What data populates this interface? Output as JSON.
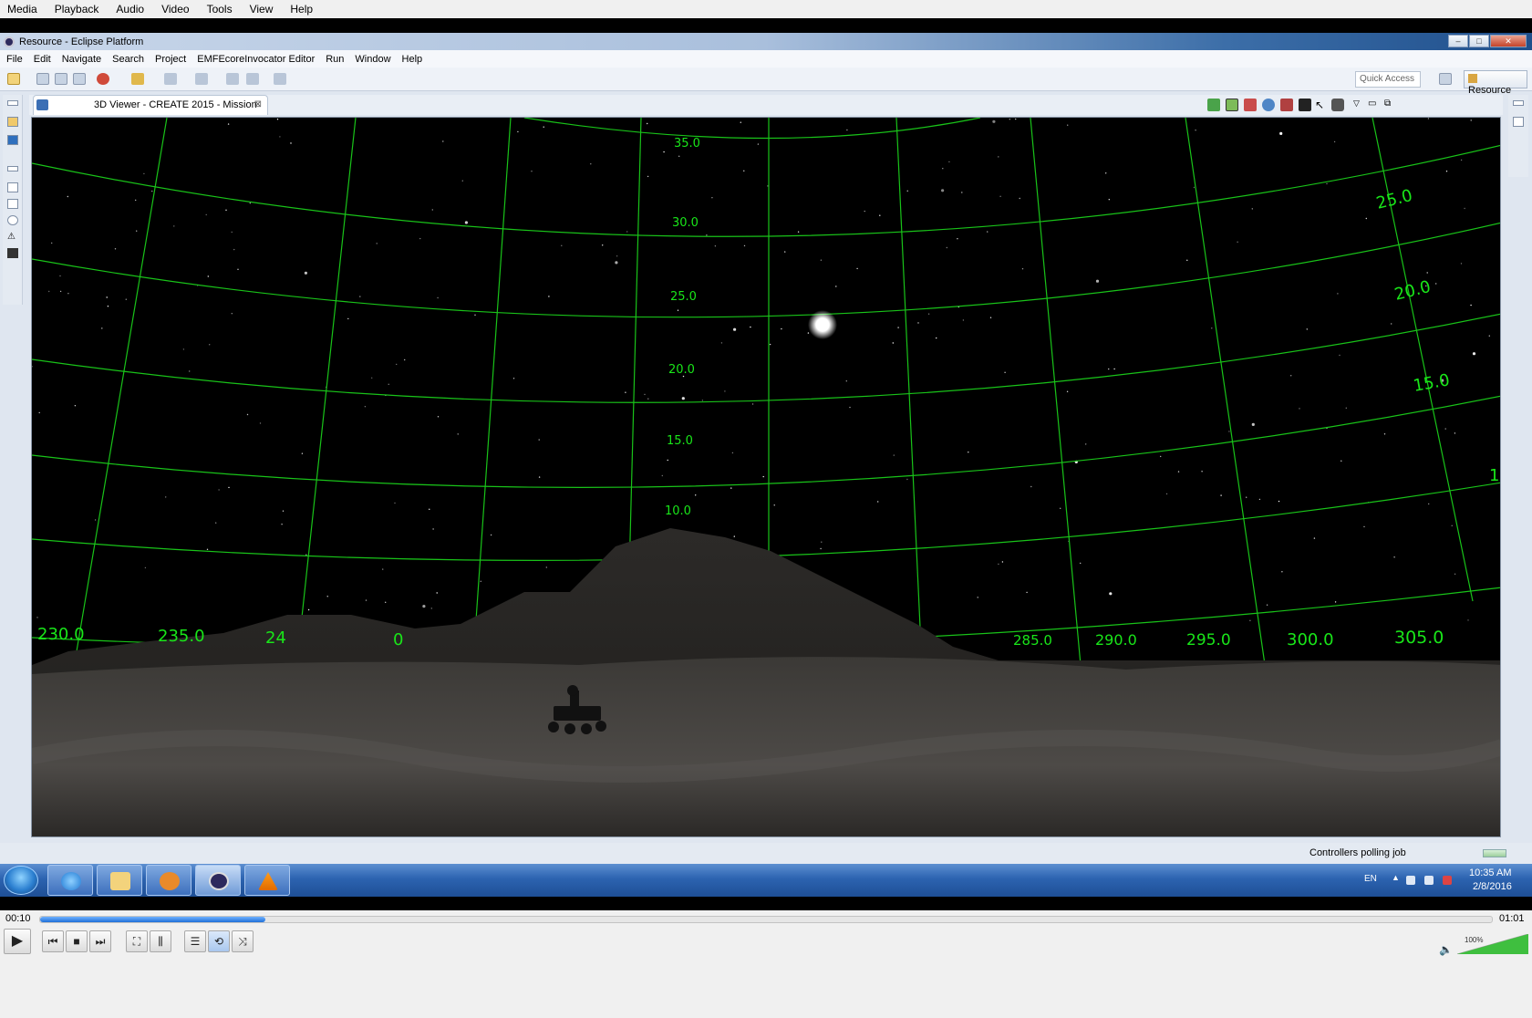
{
  "vlc": {
    "menu": [
      "Media",
      "Playback",
      "Audio",
      "Video",
      "Tools",
      "View",
      "Help"
    ],
    "time_elapsed": "00:10",
    "time_total": "01:01",
    "progress_fraction": 0.155,
    "volume_label": "100%",
    "volume_fraction": 1.0
  },
  "eclipse": {
    "window_title": "Resource - Eclipse Platform",
    "menu": [
      "File",
      "Edit",
      "Navigate",
      "Search",
      "Project",
      "EMFEcoreInvocator Editor",
      "Run",
      "Window",
      "Help"
    ],
    "quick_access_placeholder": "Quick Access",
    "perspective_label": "Resource",
    "editor_tab_title": "3D Viewer - CREATE 2015 - Mission",
    "status_text": "Controllers polling job"
  },
  "scene": {
    "elevation_labels": [
      "35.0",
      "30.0",
      "25.0",
      "20.0",
      "15.0",
      "10.0"
    ],
    "right_elevation_labels": [
      "25.0",
      "20.0",
      "15.0",
      "1"
    ],
    "azimuth_labels_left": [
      "230.0",
      "235.0",
      "24",
      "0"
    ],
    "azimuth_labels_right": [
      "285.0",
      "290.0",
      "295.0",
      "300.0",
      "305.0"
    ],
    "grid_color": "#19c319",
    "label_color": "#19e619"
  },
  "taskbar": {
    "apps": [
      "internet-explorer",
      "file-explorer",
      "media-player",
      "eclipse",
      "vlc"
    ],
    "language": "EN",
    "clock_time": "10:35 AM",
    "clock_date": "2/8/2016"
  }
}
